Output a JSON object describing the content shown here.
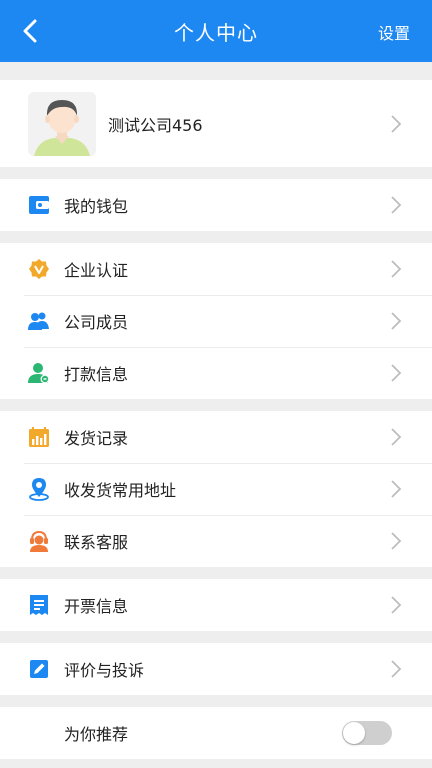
{
  "header": {
    "title": "个人中心",
    "settings_label": "设置"
  },
  "profile": {
    "company_name": "测试公司456"
  },
  "sections": {
    "wallet": {
      "label": "我的钱包",
      "icon": "wallet-icon"
    },
    "enterprise_auth": {
      "label": "企业认证",
      "icon": "verified-badge-icon"
    },
    "company_members": {
      "label": "公司成员",
      "icon": "users-icon"
    },
    "payment_info": {
      "label": "打款信息",
      "icon": "user-money-icon"
    },
    "shipment_records": {
      "label": "发货记录",
      "icon": "bar-chart-icon"
    },
    "addresses": {
      "label": "收发货常用地址",
      "icon": "location-pin-icon"
    },
    "customer_service": {
      "label": "联系客服",
      "icon": "headset-icon"
    },
    "invoice_info": {
      "label": "开票信息",
      "icon": "invoice-icon"
    },
    "reviews_complaints": {
      "label": "评价与投诉",
      "icon": "edit-icon"
    },
    "recommend": {
      "label": "为你推荐",
      "enabled": false
    }
  },
  "colors": {
    "primary": "#1e88f2",
    "icon_blue": "#1e88f2",
    "icon_gold": "#f2a92b",
    "icon_green": "#2bb673",
    "icon_orange": "#f07a3a"
  }
}
